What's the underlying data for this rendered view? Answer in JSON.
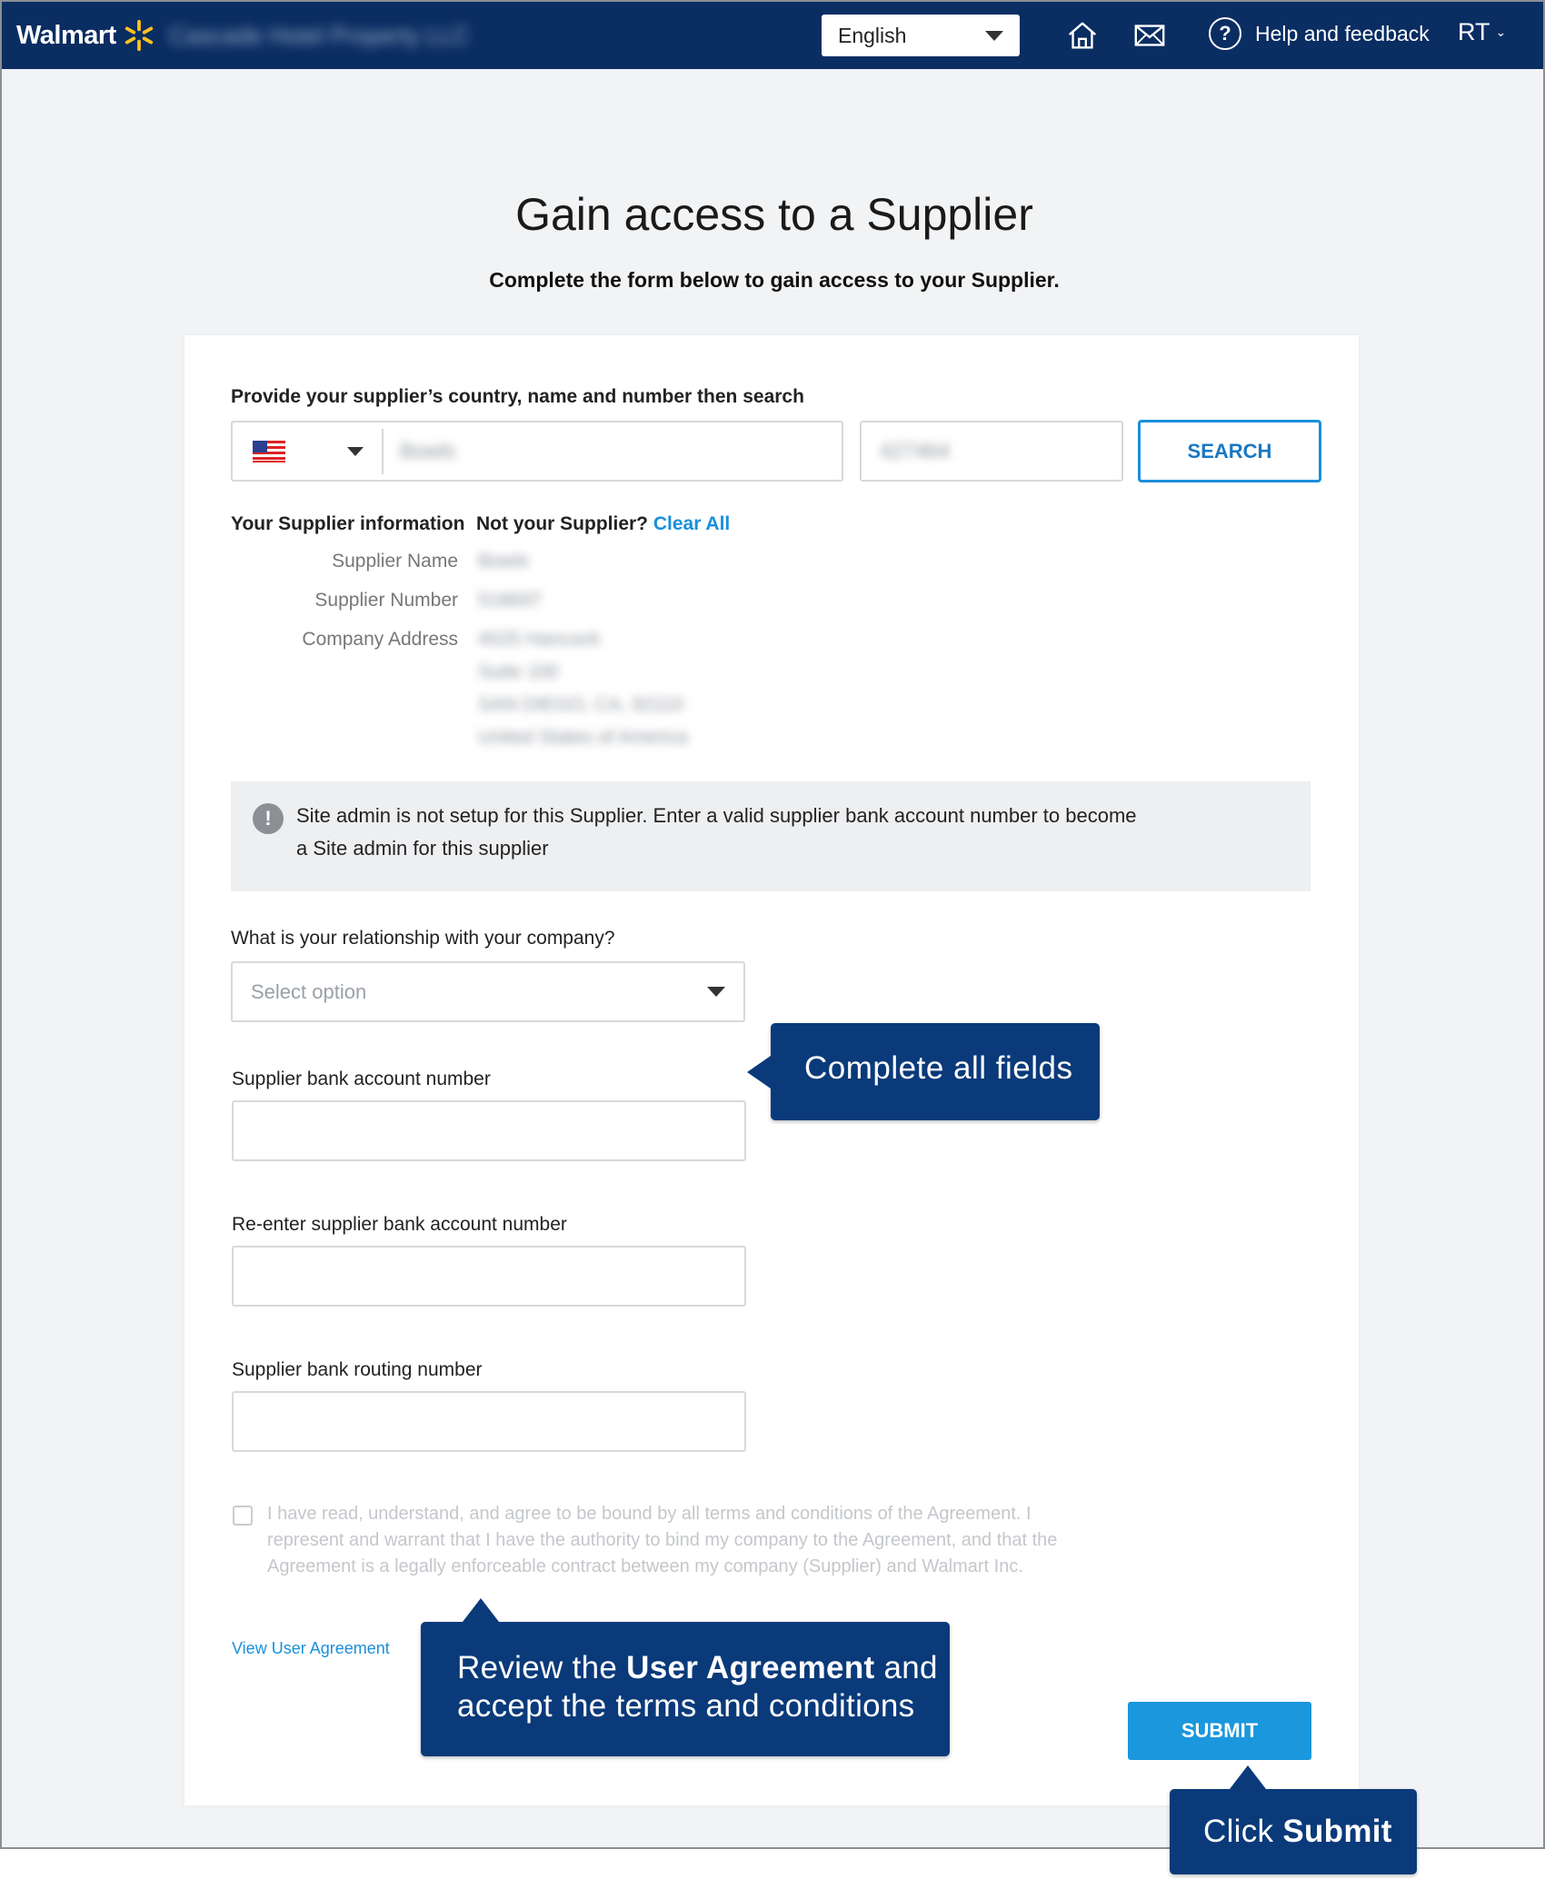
{
  "header": {
    "brand": "Walmart",
    "company_name": "Cascade Hotel Property LLC",
    "language": "English",
    "help_label": "Help and feedback",
    "user_initials": "RT",
    "icons": [
      "walmart-spark-icon",
      "home-icon",
      "mail-icon",
      "help-icon"
    ]
  },
  "page": {
    "title": "Gain access to a Supplier",
    "subtitle": "Complete the form below to gain access to your Supplier."
  },
  "search": {
    "label": "Provide your supplier’s country, name and number then search",
    "country_flag": "us-flag-icon",
    "supplier_name_value": "Bowls",
    "supplier_number_value": "427464",
    "search_button": "SEARCH"
  },
  "supplier_info": {
    "heading": "Your Supplier information",
    "not_your_supplier": "Not your Supplier?",
    "clear_all": "Clear All",
    "name_label": "Supplier Name",
    "name_value": "Bowls",
    "number_label": "Supplier Number",
    "number_value": "518697",
    "address_label": "Company Address",
    "address_lines": [
      "4025 Hancock",
      "Suite 100",
      "SAN DIEGO, CA, 92110",
      "United States of America"
    ]
  },
  "notice": {
    "line1": "Site admin is not setup for this Supplier. Enter a valid supplier bank account number to become",
    "line2": "a Site admin for this supplier"
  },
  "form": {
    "relationship_label": "What is your relationship with your company?",
    "relationship_placeholder": "Select option",
    "bank_account_label": "Supplier bank account number",
    "bank_account_reenter_label": "Re-enter supplier bank account number",
    "routing_label": "Supplier bank routing number",
    "terms_text": "I have read, understand, and agree to be bound by all terms and conditions of the Agreement. I represent and warrant that I have the authority to bind my company to the Agreement, and that the Agreement is a legally enforceable contract between my company (Supplier) and Walmart Inc.",
    "view_agreement": "View User Agreement",
    "submit": "SUBMIT"
  },
  "callouts": {
    "complete_fields": "Complete all fields",
    "review_pre": "Review the ",
    "review_bold": "User Agreement",
    "review_post": " and",
    "review_line2": "accept the terms and conditions",
    "click_pre": "Click ",
    "click_bold": "Submit"
  },
  "colors": {
    "header_bg": "#0a2d62",
    "accent_blue": "#1a97dd",
    "callout_bg": "#0a3a7a",
    "spark_yellow": "#ffc220"
  }
}
